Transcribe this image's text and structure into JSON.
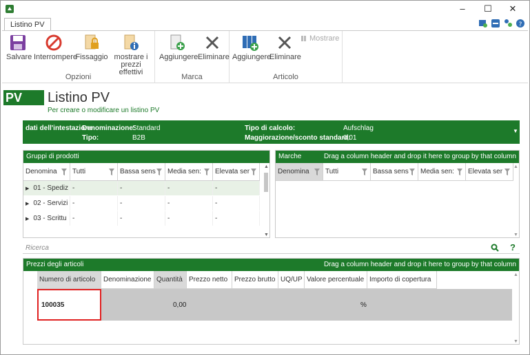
{
  "window": {
    "title_tab": "Listino PV"
  },
  "ribbon": {
    "groups": [
      {
        "label": "Opzioni"
      },
      {
        "label": "Marca"
      },
      {
        "label": "Articolo"
      }
    ],
    "buttons": {
      "save": "Salvare",
      "stop": "Interrompere",
      "fix": "Fissaggio",
      "show_prices": "mostrare i prezzi effettivi",
      "brand_add": "Aggiungere",
      "brand_delete": "Eliminare",
      "article_add": "Aggiungere",
      "article_delete": "Eliminare",
      "article_show": "Mostrare"
    }
  },
  "page": {
    "badge": "PV",
    "title": "Listino PV",
    "subtitle": "Per creare o modificare un listino PV"
  },
  "header_bar": {
    "section": "dati dell'intestazione",
    "denominazione_label": "Denominazione:",
    "denominazione_value": "Standard",
    "tipo_label": "Tipo:",
    "tipo_value": "B2B",
    "calcolo_label": "Tipo di calcolo:",
    "calcolo_value": "Aufschlag",
    "magg_label": "Maggiorazione/sconto standard:",
    "magg_value": "0,01"
  },
  "groups_panel": {
    "title": "Gruppi di prodotti",
    "columns": [
      "Denomina",
      "Tutti",
      "Bassa sens",
      "Media sen:",
      "Elevata ser"
    ],
    "rows": [
      [
        "01 - Spediz",
        "-",
        "-",
        "-",
        "-"
      ],
      [
        "02 - Servizi",
        "-",
        "-",
        "-",
        "-"
      ],
      [
        "03 - Scrittu",
        "-",
        "-",
        "-",
        "-"
      ]
    ]
  },
  "brands_panel": {
    "title": "Marche",
    "hint": "Drag a column header and drop it here to group by that column",
    "columns": [
      "Denomina",
      "Tutti",
      "Bassa sens",
      "Media sen:",
      "Elevata ser"
    ]
  },
  "search": {
    "placeholder": "Ricerca"
  },
  "prices_panel": {
    "title": "Prezzi degli articoli",
    "hint": "Drag a column header and drop it here to group by that column",
    "columns": [
      "Numero di articolo",
      "Denominazione",
      "Quantità",
      "Prezzo netto",
      "Prezzo brutto",
      "UQ/UP",
      "Valore percentuale",
      "Importo di copertura"
    ],
    "row": {
      "article": "100035",
      "qty": "0,00",
      "percent": "%"
    }
  },
  "colors": {
    "brand_green": "#1d7a2a",
    "highlight_red": "#e02020"
  }
}
